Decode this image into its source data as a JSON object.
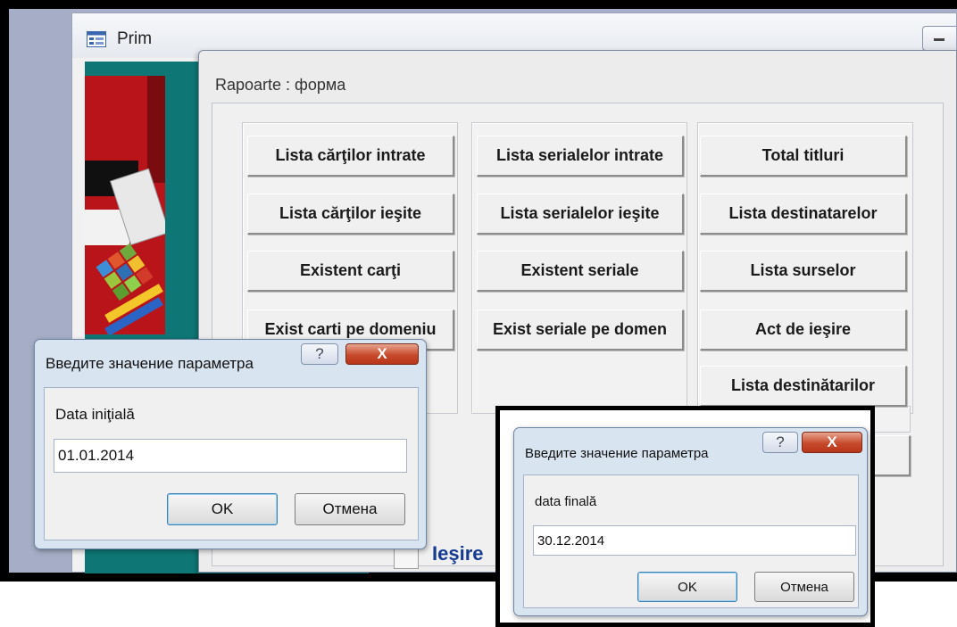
{
  "prim": {
    "title": "Prim"
  },
  "rapoarte": {
    "title": "Rapoarte : форма",
    "col1": [
      "Lista cărţilor intrate",
      "Lista cărţilor ieşite",
      "Existent carţi",
      "Exist carti pe domeniu"
    ],
    "col2": [
      "Lista serialelor intrate",
      "Lista serialelor ieşite",
      "Existent seriale",
      "Exist seriale pe domen"
    ],
    "col3": [
      "Total titluri",
      "Lista destinatarelor",
      "Lista surselor",
      "Act de ieşire",
      "Lista destinătarilor"
    ],
    "exit_label": "Ieşire"
  },
  "dialog1": {
    "title": "Введите значение параметра",
    "help_glyph": "?",
    "close_glyph": "X",
    "label": "Data iniţială",
    "value": "01.01.2014",
    "ok": "OK",
    "cancel": "Отмена"
  },
  "dialog2": {
    "title": "Введите значение параметра",
    "help_glyph": "?",
    "close_glyph": "X",
    "label": "data finală",
    "value": "30.12.2014",
    "ok": "OK",
    "cancel": "Отмена"
  }
}
